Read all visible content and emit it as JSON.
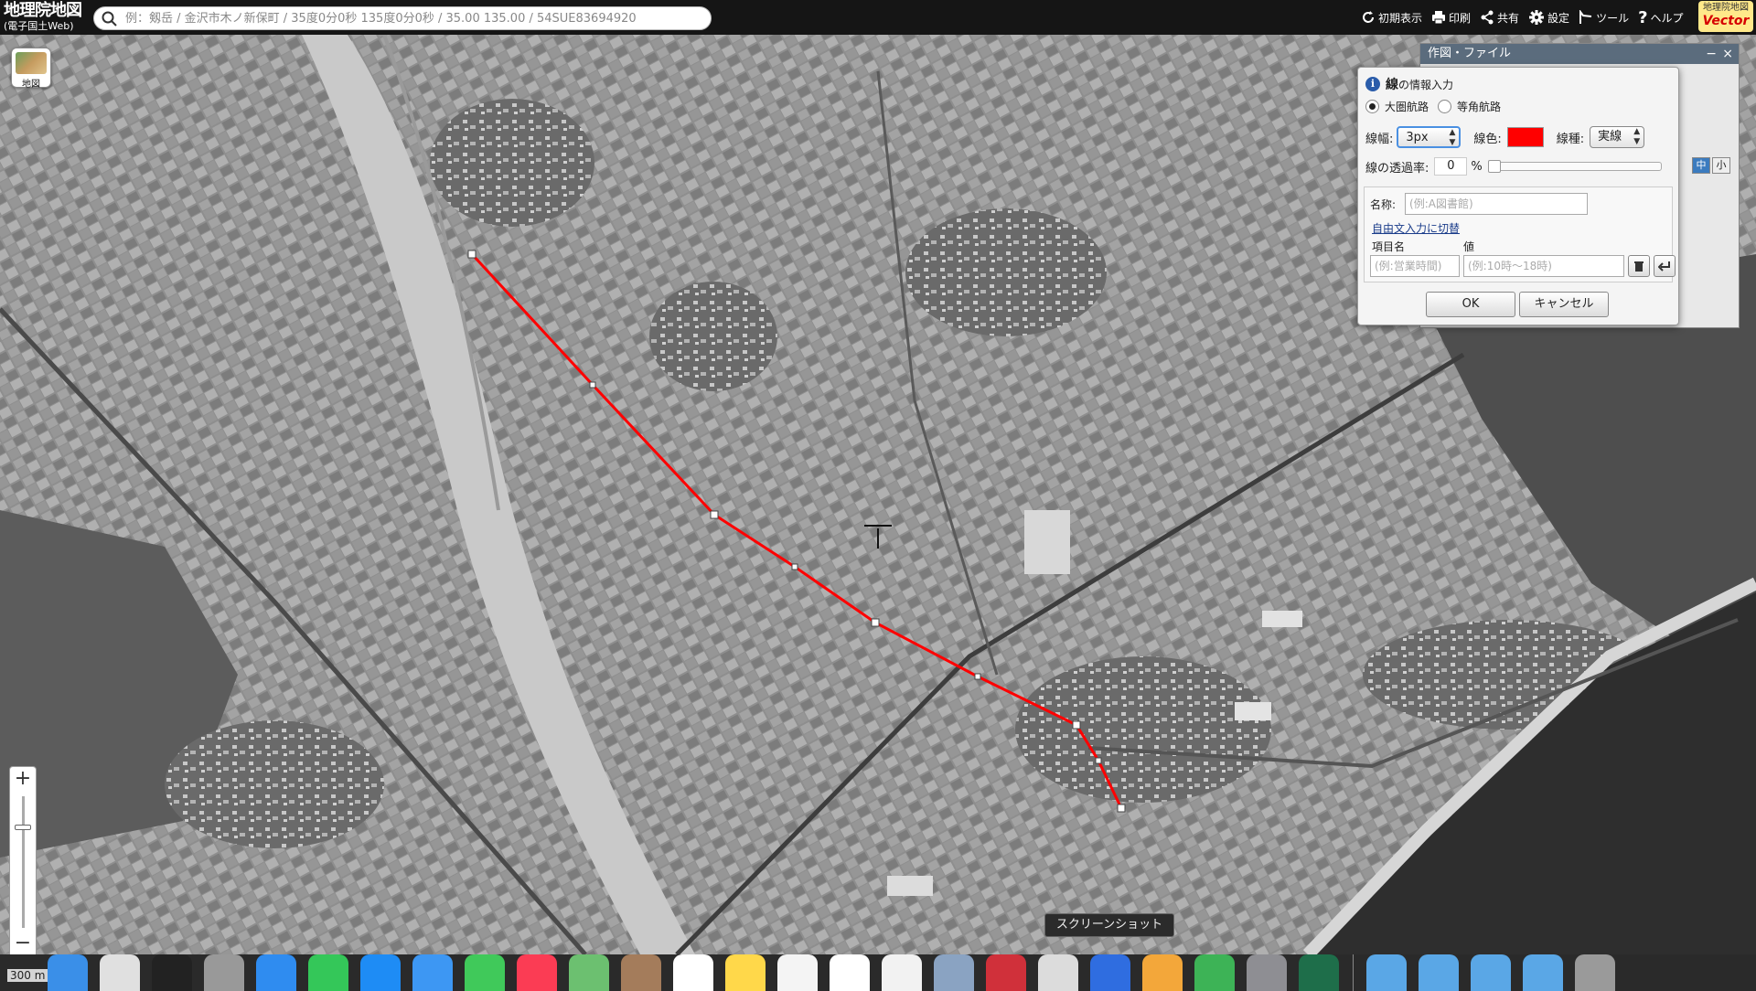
{
  "header": {
    "logo_main": "地理院地図",
    "logo_sub": "(電子国土Web)",
    "search_placeholder": "例：剱岳 / 金沢市木ノ新保町 / 35度0分0秒 135度0分0秒 / 35.00 135.00 / 54SUE83694920",
    "tools": [
      {
        "label": "初期表示",
        "icon": "reset-view-icon"
      },
      {
        "label": "印刷",
        "icon": "printer-icon"
      },
      {
        "label": "共有",
        "icon": "share-icon"
      },
      {
        "label": "設定",
        "icon": "gear-icon"
      },
      {
        "label": "ツール",
        "icon": "tools-icon"
      },
      {
        "label": "ヘルプ",
        "icon": "help-icon"
      }
    ],
    "vector_logo_top": "地理院地図",
    "vector_logo_bottom": "Vector"
  },
  "map": {
    "layer_button_label": "地図",
    "zoom_in": "+",
    "zoom_out": "−",
    "scale": "300 m",
    "line_color": "#ff0000"
  },
  "outer_dialog": {
    "title": "作図・ファイル",
    "minimize": "−",
    "close": "×",
    "size_buttons": [
      "中",
      "小"
    ]
  },
  "line_dialog": {
    "title_bold": "線",
    "title_rest": "の情報入力",
    "route_options": [
      {
        "label": "大圏航路",
        "selected": true
      },
      {
        "label": "等角航路",
        "selected": false
      }
    ],
    "width_label": "線幅:",
    "width_value": "3px",
    "color_label": "線色:",
    "color_value": "#ff0000",
    "type_label": "線種:",
    "type_value": "実線",
    "opacity_label": "線の透過率:",
    "opacity_value": "0",
    "opacity_unit": "%",
    "name_label": "名称:",
    "name_placeholder": "(例:A図書館)",
    "freetext_link": "自由文入力に切替",
    "item_col": "項目名",
    "value_col": "値",
    "item_placeholder": "(例:営業時間)",
    "value_placeholder": "(例:10時〜18時)",
    "ok": "OK",
    "cancel": "キャンセル"
  },
  "tooltip": "スクリーンショット",
  "dock": {
    "apps": [
      {
        "name": "finder-icon",
        "color": "#3a8fe8"
      },
      {
        "name": "launchpad-icon",
        "color": "#e0e0e0"
      },
      {
        "name": "calculator-like-icon",
        "color": "#222222"
      },
      {
        "name": "calculator-icon",
        "color": "#999999"
      },
      {
        "name": "safari-icon",
        "color": "#2f8cf0"
      },
      {
        "name": "findmy-icon",
        "color": "#34c759"
      },
      {
        "name": "appstore-icon",
        "color": "#1e8cf5"
      },
      {
        "name": "mail-icon",
        "color": "#3d97f3"
      },
      {
        "name": "messages-icon",
        "color": "#40c95a"
      },
      {
        "name": "music-icon",
        "color": "#fb3c54"
      },
      {
        "name": "maps-icon",
        "color": "#6cc070"
      },
      {
        "name": "contacts-icon",
        "color": "#a47c5b"
      },
      {
        "name": "calendar-icon",
        "color": "#ffffff"
      },
      {
        "name": "notes-icon",
        "color": "#ffd84a"
      },
      {
        "name": "textedit-icon",
        "color": "#f4f4f4"
      },
      {
        "name": "reminders-icon",
        "color": "#ffffff"
      },
      {
        "name": "photos-icon",
        "color": "#f2f2f2"
      },
      {
        "name": "preview-icon",
        "color": "#8aa3c2"
      },
      {
        "name": "photobooth-icon",
        "color": "#d0303a"
      },
      {
        "name": "screenshot-icon",
        "color": "#dcdcdc"
      },
      {
        "name": "keynote-icon",
        "color": "#2f6de0"
      },
      {
        "name": "pages-icon",
        "color": "#f3a73a"
      },
      {
        "name": "numbers-icon",
        "color": "#3db356"
      },
      {
        "name": "system-settings-icon",
        "color": "#8e8e93"
      },
      {
        "name": "time-machine-icon",
        "color": "#1e6e4a"
      },
      {
        "name": "divider",
        "color": ""
      },
      {
        "name": "folder-icon",
        "color": "#5aa7e6"
      },
      {
        "name": "applications-folder-icon",
        "color": "#5aa7e6"
      },
      {
        "name": "documents-folder-icon",
        "color": "#5aa7e6"
      },
      {
        "name": "downloads-folder-icon",
        "color": "#5aa7e6"
      },
      {
        "name": "trash-icon",
        "color": "#9a9a9a"
      }
    ]
  }
}
